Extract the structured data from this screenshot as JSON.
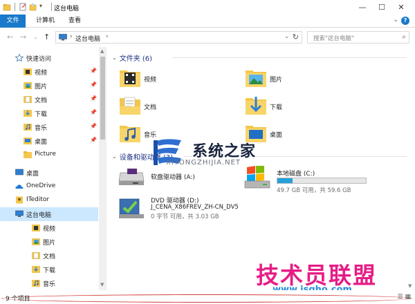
{
  "window": {
    "title": "这台电脑",
    "minimize_icon": "minimize-icon",
    "maximize_icon": "maximize-icon",
    "close_icon": "close-icon"
  },
  "ribbon": {
    "tabs": [
      {
        "label": "文件"
      },
      {
        "label": "计算机"
      },
      {
        "label": "查看"
      }
    ]
  },
  "address_bar": {
    "path": "这台电脑",
    "search_placeholder": "搜索\"这台电脑\""
  },
  "nav_pane": {
    "items": [
      {
        "label": "快速访问",
        "icon": "star-icon"
      },
      {
        "label": "视频",
        "icon": "video-folder-icon",
        "pinned": true
      },
      {
        "label": "图片",
        "icon": "pictures-folder-icon",
        "pinned": true
      },
      {
        "label": "文档",
        "icon": "documents-folder-icon",
        "pinned": true
      },
      {
        "label": "下载",
        "icon": "downloads-folder-icon",
        "pinned": true
      },
      {
        "label": "音乐",
        "icon": "music-folder-icon",
        "pinned": true
      },
      {
        "label": "桌面",
        "icon": "desktop-folder-icon",
        "pinned": true
      },
      {
        "label": "Picture",
        "icon": "folder-icon"
      },
      {
        "label": "桌面",
        "icon": "desktop-icon"
      },
      {
        "label": "OneDrive",
        "icon": "onedrive-icon"
      },
      {
        "label": "ITeditor",
        "icon": "user-icon"
      },
      {
        "label": "这台电脑",
        "icon": "computer-icon",
        "selected": true
      },
      {
        "label": "视频",
        "icon": "video-folder-icon"
      },
      {
        "label": "图片",
        "icon": "pictures-folder-icon"
      },
      {
        "label": "文档",
        "icon": "documents-folder-icon"
      },
      {
        "label": "下载",
        "icon": "downloads-folder-icon"
      },
      {
        "label": "音乐",
        "icon": "music-folder-icon"
      }
    ]
  },
  "content": {
    "folders_header": "文件夹 (6)",
    "folders": [
      {
        "label": "视频",
        "icon": "video-folder-icon"
      },
      {
        "label": "图片",
        "icon": "pictures-folder-icon"
      },
      {
        "label": "文档",
        "icon": "documents-folder-icon"
      },
      {
        "label": "下载",
        "icon": "downloads-folder-icon"
      },
      {
        "label": "音乐",
        "icon": "music-folder-icon"
      },
      {
        "label": "桌面",
        "icon": "desktop-folder-icon"
      }
    ],
    "devices_header": "设备和驱动器 (3)",
    "drives": [
      {
        "name": "软盘驱动器 (A:)",
        "icon": "floppy-drive-icon"
      },
      {
        "name": "本地磁盘 (C:)",
        "icon": "local-disk-icon",
        "info": "49.7 GB 可用，共 59.6 GB",
        "used_fraction": 0.17
      },
      {
        "name": "DVD 驱动器 (D:)",
        "icon": "dvd-drive-icon",
        "volume": "J_CENA_X86FREV_ZH-CN_DV5",
        "info": "0 字节 可用，共 3.03 GB"
      }
    ]
  },
  "watermarks": {
    "site1_name": "系统之家",
    "site1_url": "XITONGZHIJIA.NET",
    "site2_name": "技术员联盟",
    "site2_url": "www.jsgho.com"
  },
  "status_bar": {
    "item_count": "9 个项目"
  },
  "colors": {
    "accent": "#1979ca",
    "selection": "#cce8ff",
    "drive_bar": "#26a0da",
    "header_text": "#1e3287"
  }
}
